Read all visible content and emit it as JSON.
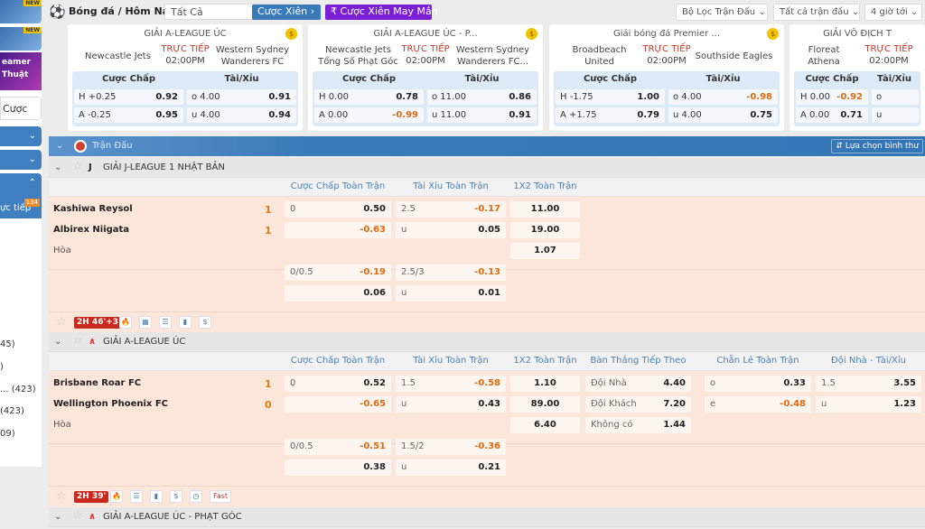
{
  "sidebar": {
    "promo_badge": "NEW",
    "streamer_text": "eamer Thuật",
    "search_label": "Cược",
    "live_label": "ực tiếp",
    "live_count": "134",
    "counts": [
      "45)",
      ")",
      "...  (423)",
      "(423)",
      "09)"
    ]
  },
  "topbar": {
    "title": "Bóng đá / Hôm Nay",
    "select_value": "Tất Cả",
    "parlay_btn": "Cược Xiên",
    "lucky_btn": "Cược Xiên May Mắn",
    "filters": [
      "Bộ Lọc Trận Đấu",
      "Tất cả trận đấu",
      "4 giờ tới"
    ]
  },
  "cards": [
    {
      "league": "GIẢI A-LEAGUE ÚC",
      "home": "Newcastle Jets",
      "away": "Western Sydney Wanderers FC",
      "live": "TRỰC TIẾP",
      "time": "02:00PM",
      "hdp_label": "Cược Chấp",
      "ou_label": "Tài/Xỉu",
      "hdp": [
        [
          "H +0.25",
          "0.92"
        ],
        [
          "A -0.25",
          "0.95"
        ]
      ],
      "ou": [
        [
          "o 4.00",
          "0.91"
        ],
        [
          "u 4.00",
          "0.94"
        ]
      ]
    },
    {
      "league": "GIẢI A-LEAGUE ÚC - P...",
      "home": "Newcastle Jets Tổng Số Phạt Góc",
      "away": "Western Sydney Wanderers FC...",
      "live": "TRỰC TIẾP",
      "time": "02:00PM",
      "hdp_label": "Cược Chấp",
      "ou_label": "Tài/Xỉu",
      "hdp": [
        [
          "H 0.00",
          "0.78"
        ],
        [
          "A 0.00",
          "-0.99"
        ]
      ],
      "ou": [
        [
          "o 11.00",
          "0.86"
        ],
        [
          "u 11.00",
          "0.91"
        ]
      ]
    },
    {
      "league": "Giải bóng đá Premier ...",
      "home": "Broadbeach United",
      "away": "Southside Eagles",
      "live": "TRỰC TIẾP",
      "time": "02:00PM",
      "hdp_label": "Cược Chấp",
      "ou_label": "Tài/Xỉu",
      "hdp": [
        [
          "H -1.75",
          "1.00"
        ],
        [
          "A +1.75",
          "0.79"
        ]
      ],
      "ou": [
        [
          "o 4.00",
          "-0.98"
        ],
        [
          "u 4.00",
          "0.75"
        ]
      ]
    },
    {
      "league": "GIẢI VÔ ĐỊCH T",
      "home": "Floreat Athena",
      "away": "",
      "live": "TRỰC TIẾP",
      "time": "02:00PM",
      "hdp_label": "Cược Chấp",
      "ou_label": "Tài/Xỉu",
      "hdp": [
        [
          "H 0.00",
          "-0.92"
        ],
        [
          "A 0.00",
          "0.71"
        ]
      ],
      "ou": [
        [
          "o",
          ""
        ],
        [
          "u",
          ""
        ]
      ]
    }
  ],
  "main": {
    "header": "Trận Đấu",
    "sort_btn": "Lựa chọn bình thư",
    "col_headers": [
      "Cược Chấp Toàn Trận",
      "Tài Xỉu Toàn Trận",
      "1X2 Toàn Trận",
      "Bàn Thắng Tiếp Theo",
      "Chẵn Lẻ Toàn Trận",
      "Đội Nhà - Tài/Xỉu"
    ],
    "leagues": [
      {
        "name": "GIẢI J-LEAGUE 1 NHẬT BẢN",
        "home": "Kashiwa Reysol",
        "away": "Albirex Niigata",
        "draw": "Hòa",
        "home_score": "1",
        "away_score": "1",
        "time": "2H 46'+3",
        "hdp": [
          [
            "0",
            "0.50"
          ],
          [
            "",
            "-0.63"
          ],
          [
            "0/0.5",
            "-0.19"
          ],
          [
            "",
            "0.06"
          ]
        ],
        "ou": [
          [
            "2.5",
            "-0.17"
          ],
          [
            "u",
            "0.05"
          ],
          [
            "2.5/3",
            "-0.13"
          ],
          [
            "u",
            "0.01"
          ]
        ],
        "x12": [
          "11.00",
          "19.00",
          "1.07"
        ]
      },
      {
        "name": "GIẢI A-LEAGUE ÚC",
        "home": "Brisbane Roar FC",
        "away": "Wellington Phoenix FC",
        "draw": "Hòa",
        "home_score": "1",
        "away_score": "0",
        "time": "2H 39'",
        "fast": "Fast",
        "hdp": [
          [
            "0",
            "0.52"
          ],
          [
            "",
            "-0.65"
          ],
          [
            "0/0.5",
            "-0.51"
          ],
          [
            "",
            "0.38"
          ]
        ],
        "ou": [
          [
            "1.5",
            "-0.58"
          ],
          [
            "u",
            "0.43"
          ],
          [
            "1.5/2",
            "-0.36"
          ],
          [
            "u",
            "0.21"
          ]
        ],
        "x12": [
          "1.10",
          "89.00",
          "6.40"
        ],
        "next_goal": [
          [
            "Đội Nhà",
            "4.40"
          ],
          [
            "Đội Khách",
            "7.20"
          ],
          [
            "Không có",
            "1.44"
          ]
        ],
        "odd_even": [
          [
            "o",
            "0.33"
          ],
          [
            "e",
            "-0.48"
          ]
        ],
        "home_ou": [
          [
            "1.5",
            "3.55"
          ],
          [
            "u",
            "1.23"
          ]
        ]
      },
      {
        "name": "GIẢI A-LEAGUE ÚC - PHẠT GÓC"
      }
    ]
  },
  "colors": {
    "blue": "#3476b5",
    "live": "#c0392b",
    "negative": "#e06a10",
    "match_bg": "#fbe6d9",
    "lucky": "#7a1fd6"
  }
}
